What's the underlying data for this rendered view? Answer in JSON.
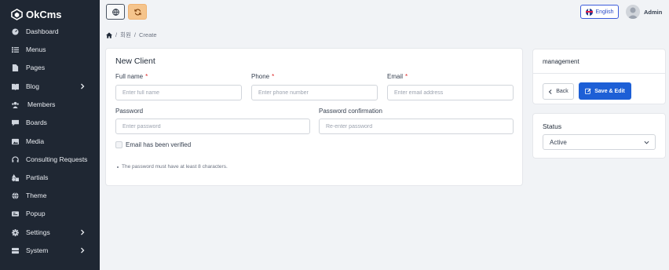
{
  "app": {
    "name": "OkCms"
  },
  "sidebar": {
    "items": [
      {
        "label": "Dashboard",
        "icon": "dashboard-icon"
      },
      {
        "label": "Menus",
        "icon": "list-icon"
      },
      {
        "label": "Pages",
        "icon": "pages-icon"
      },
      {
        "label": "Blog",
        "icon": "blog-icon",
        "has_children": true
      },
      {
        "label": "Members",
        "icon": "members-icon"
      },
      {
        "label": "Boards",
        "icon": "boards-icon"
      },
      {
        "label": "Media",
        "icon": "media-icon"
      },
      {
        "label": "Consulting Requests",
        "icon": "headset-icon"
      },
      {
        "label": "Partials",
        "icon": "shapes-icon"
      },
      {
        "label": "Theme",
        "icon": "theme-icon"
      },
      {
        "label": "Popup",
        "icon": "popup-icon"
      },
      {
        "label": "Settings",
        "icon": "gear-icon",
        "has_children": true
      },
      {
        "label": "System",
        "icon": "server-icon",
        "has_children": true
      }
    ]
  },
  "topbar": {
    "language_label": "English",
    "user_name": "Admin"
  },
  "breadcrumb": {
    "sep": "/",
    "items": [
      "회원",
      "Create"
    ]
  },
  "form": {
    "title": "New Client",
    "full_name": {
      "label": "Full name",
      "required_mark": "*",
      "placeholder": "Enter full name"
    },
    "phone": {
      "label": "Phone",
      "required_mark": "*",
      "placeholder": "Enter phone number"
    },
    "email": {
      "label": "Email",
      "required_mark": "*",
      "placeholder": "Enter email address"
    },
    "password": {
      "label": "Password",
      "placeholder": "Enter password"
    },
    "password_confirmation": {
      "label": "Password confirmation",
      "placeholder": "Re-enter password"
    },
    "email_verified_label": "Email has been verified",
    "hint": "The password must have at least 8 characters."
  },
  "management": {
    "title": "management",
    "back_label": "Back",
    "save_label": "Save & Edit"
  },
  "status": {
    "title": "Status",
    "selected": "Active"
  },
  "colors": {
    "sidebar_bg": "#1f2733",
    "primary": "#1d5fd6",
    "refresh_button": "#f5c48c",
    "required": "#dc2626"
  }
}
